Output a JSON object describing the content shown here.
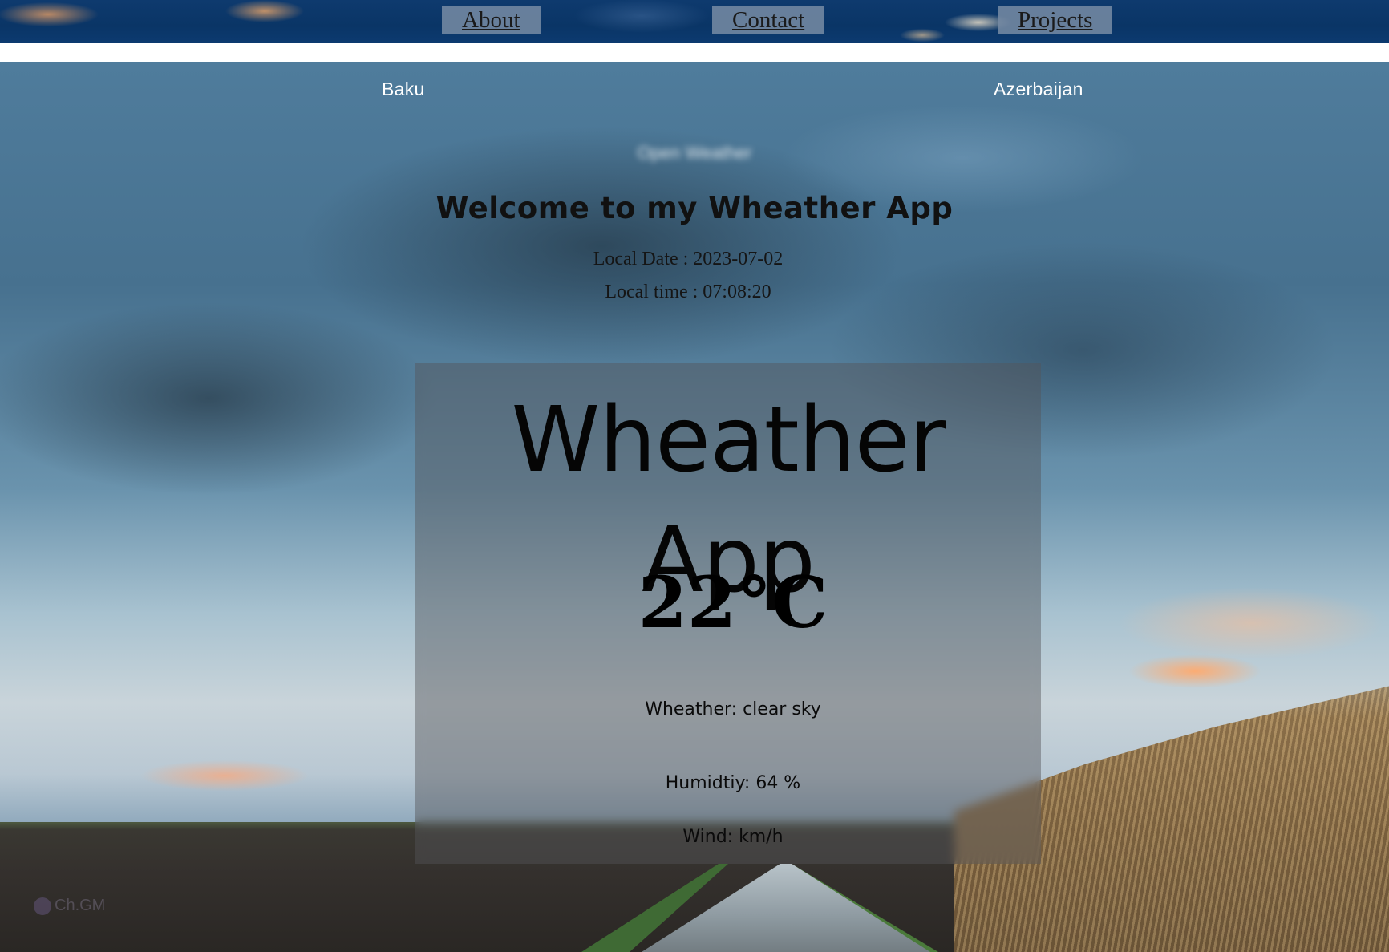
{
  "nav": {
    "about": "About",
    "contact": "Contact",
    "projects": "Projects"
  },
  "location": {
    "city": "Baku",
    "country": "Azerbaijan"
  },
  "header": {
    "blurred_title": "Open Weather",
    "welcome": "Welcome to my Wheather App",
    "local_date": "Local Date : 2023-07-02",
    "local_time": "Local time : 07:08:20"
  },
  "card": {
    "title": "Wheather App",
    "temperature": "22°C",
    "weather": "Wheather: clear sky",
    "humidity": "Humidtiy: 64 %",
    "wind": "Wind: km/h"
  },
  "watermark": {
    "text": "Ch.GM"
  }
}
